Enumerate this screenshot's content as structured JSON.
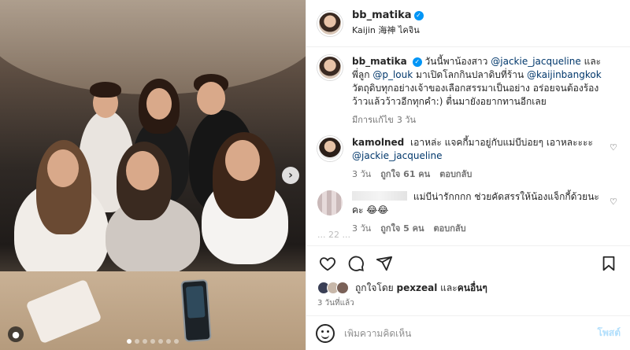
{
  "post": {
    "username": "bb_matika",
    "location": "Kaijin 海神 ไคจิน"
  },
  "caption": {
    "username": "bb_matika",
    "text_1": "วันนี้พาน้องสาว",
    "mention_1": "@jackie_jacqueline",
    "text_2": "และพี่ลูก",
    "mention_2": "@p_louk",
    "text_3": "มาเปิดโลกกินปลาดิบที่ร้าน",
    "mention_3": "@kaijinbangkok",
    "text_4": "วัตถุดิบทุกอย่างเจ้าของเลือกสรรมาเป็นอย่าง อร่อยจนต้องร้องว้าวแล้วว้าวอีกทุกคำ:) ตื่นมายังอยากทานอีกเลย",
    "edited": "มีการแก้ไข",
    "time": "3 วัน"
  },
  "comments": [
    {
      "username": "kamolned",
      "text": "เอาหล่ะ แจคกี้มาอยู่กับแม่บีบ่อยๆ เอาหละะะะ",
      "mention": "@jackie_jacqueline",
      "time": "3 วัน",
      "likes": "ถูกใจ 61 คน",
      "reply": "ตอบกลับ"
    },
    {
      "username": "",
      "text": "แม่บีน่ารักกกก ช่วยคัดสรรให้น้องแจ็กกี้ด้วยนะคะ 😂😂",
      "time": "3 วัน",
      "likes": "ถูกใจ 5 คน",
      "reply": "ตอบกลับ"
    }
  ],
  "faded_comment": "... 22 ...",
  "likes_line": {
    "prefix": "ถูกใจโดย",
    "user": "pexzeal",
    "middle": "และ",
    "others": "คนอื่นๆ"
  },
  "post_time": "3 วันที่แล้ว",
  "add_comment": {
    "placeholder": "เพิ่มความคิดเห็น",
    "post_label": "โพสต์"
  },
  "icons": {
    "heart": "heart-icon",
    "comment": "comment-icon",
    "share": "share-icon",
    "save": "bookmark-icon",
    "emoji": "emoji-icon",
    "verified": "verified-badge-icon",
    "next": "chevron-right-icon"
  },
  "colors": {
    "verified": "#0095f6",
    "mention": "#00376b",
    "post_button": "#b2dffc",
    "muted": "#737373"
  },
  "carousel": {
    "total_slides": 7,
    "current_slide": 1
  }
}
